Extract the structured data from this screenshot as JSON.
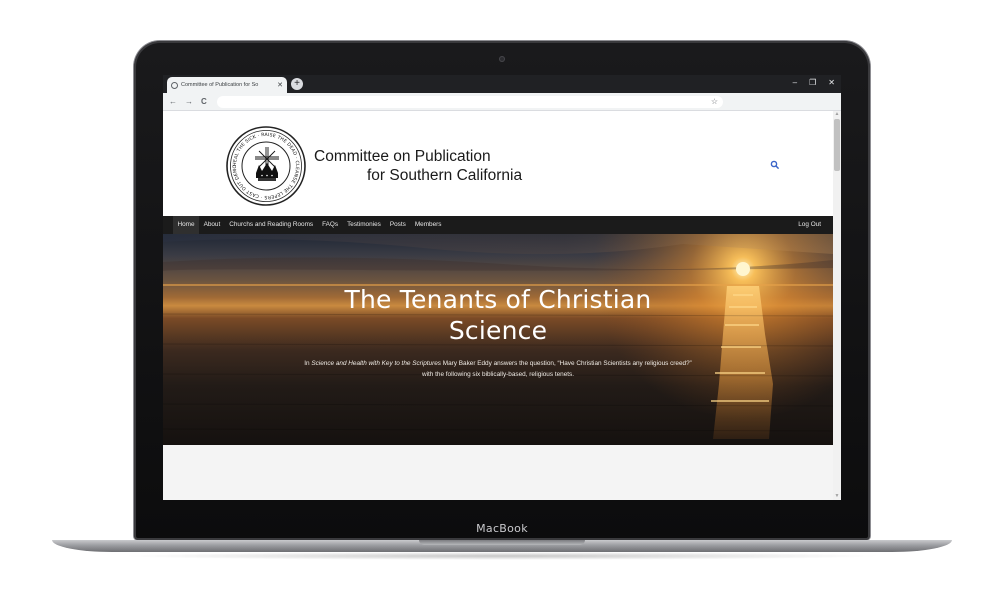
{
  "browser": {
    "tab_title": "Committee of Publication for So",
    "tab_close": "✕",
    "new_tab": "+",
    "minimize": "–",
    "restore": "❐",
    "close": "✕",
    "back": "←",
    "forward": "→",
    "reload": "C",
    "bookmark": "☆",
    "address": ""
  },
  "site": {
    "title_line1": "Committee on Publication",
    "title_line2": "for Southern California",
    "seal_text": "HEAL THE SICK · RAISE THE DEAD · CLEANSE THE LEPERS · CAST OUT DEMONS"
  },
  "nav": {
    "items": [
      {
        "label": "Home",
        "active": true
      },
      {
        "label": "About"
      },
      {
        "label": "Churchs and Reading Rooms"
      },
      {
        "label": "FAQs"
      },
      {
        "label": "Testimonies"
      },
      {
        "label": "Posts"
      },
      {
        "label": "Members"
      }
    ],
    "logout": "Log Out"
  },
  "hero": {
    "title_line1": "The Tenants of Christian",
    "title_line2": "Science",
    "text_prefix": "In ",
    "text_book": "Science and Health with Key to the Scriptures",
    "text_middle": " Mary Baker Eddy answers the question, “Have Christian Scientists any religious creed?”",
    "text_line2": "with the following six biblically-based, religious tenets."
  },
  "device": {
    "label": "MacBook"
  },
  "colors": {
    "nav_bg": "#1b1b1b",
    "search_icon": "#3a64c8",
    "chrome_dark": "#202124"
  }
}
